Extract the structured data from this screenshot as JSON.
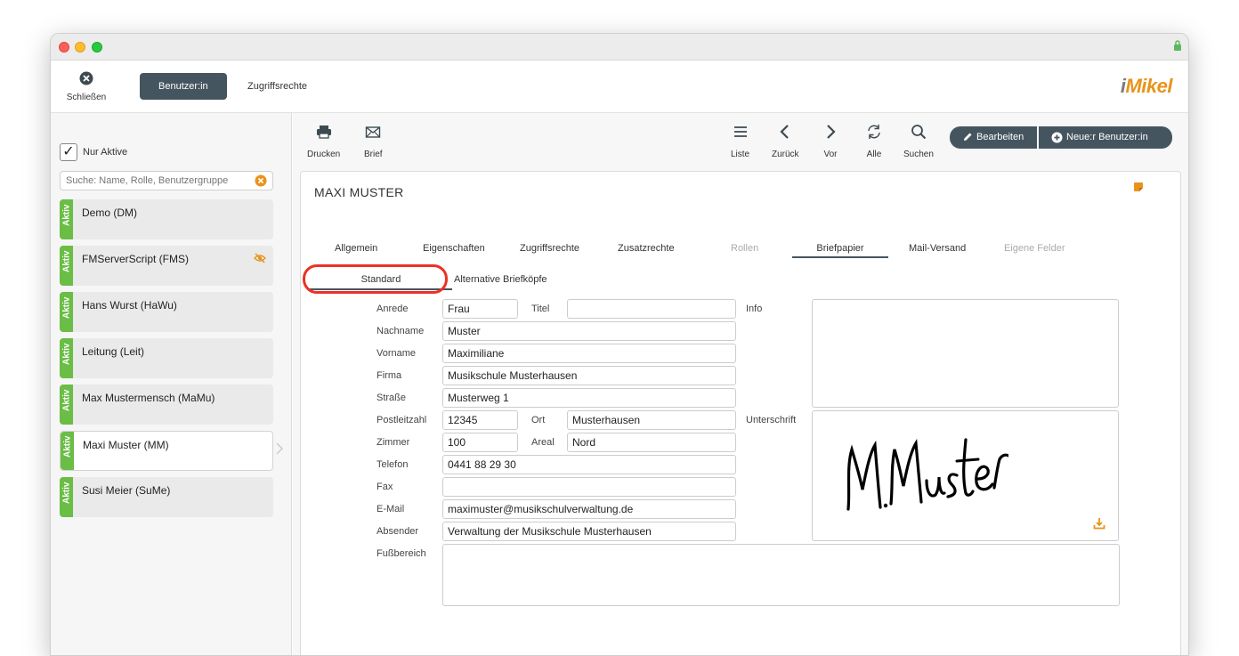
{
  "window": {
    "colors": {
      "accent": "#455560",
      "status_green": "#6abd45",
      "highlight_red": "#ee3024",
      "brand_orange": "#e8931a"
    }
  },
  "topbar": {
    "close_label": "Schließen",
    "tab_user": "Benutzer:in",
    "tab_access": "Zugriffsrechte",
    "logo_i": "i",
    "logo_rest": "Mikel"
  },
  "sidebar": {
    "only_active_label": "Nur Aktive",
    "only_active_checked": "✓",
    "search_placeholder": "Suche: Name, Rolle, Benutzergruppe",
    "status_label": "Aktiv",
    "users": [
      {
        "name": "Demo (DM)"
      },
      {
        "name": "FMServerScript (FMS)"
      },
      {
        "name": "Hans Wurst (HaWu)"
      },
      {
        "name": "Leitung (Leit)"
      },
      {
        "name": "Max Mustermensch (MaMu)"
      },
      {
        "name": "Maxi Muster (MM)"
      },
      {
        "name": "Susi Meier (SuMe)"
      }
    ]
  },
  "toolbar": {
    "print": "Drucken",
    "letter": "Brief",
    "list": "Liste",
    "back": "Zurück",
    "next": "Vor",
    "all": "Alle",
    "search": "Suchen",
    "edit": "Bearbeiten",
    "new_user": "Neue:r Benutzer:in"
  },
  "record": {
    "title": "MAXI MUSTER",
    "tabs": {
      "general": "Allgemein",
      "properties": "Eigenschaften",
      "access": "Zugriffsrechte",
      "extra": "Zusatzrechte",
      "roles": "Rollen",
      "letterhead": "Briefpapier",
      "mail": "Mail-Versand",
      "custom": "Eigene Felder"
    },
    "subtabs": {
      "standard": "Standard",
      "alternative": "Alternative Briefköpfe"
    },
    "labels": {
      "salutation": "Anrede",
      "title": "Titel",
      "info": "Info",
      "lastname": "Nachname",
      "firstname": "Vorname",
      "company": "Firma",
      "street": "Straße",
      "zip": "Postleitzahl",
      "city": "Ort",
      "signature": "Unterschrift",
      "room": "Zimmer",
      "area": "Areal",
      "phone": "Telefon",
      "fax": "Fax",
      "email": "E-Mail",
      "sender": "Absender",
      "footer": "Fußbereich"
    },
    "values": {
      "salutation": "Frau",
      "title": "",
      "lastname": "Muster",
      "firstname": "Maximiliane",
      "company": "Musikschule Musterhausen",
      "street": "Musterweg 1",
      "zip": "12345",
      "city": "Musterhausen",
      "room": "100",
      "area": "Nord",
      "phone": "0441 88 29 30",
      "fax": "",
      "email": "maximuster@musikschulverwaltung.de",
      "sender": "Verwaltung der Musikschule Musterhausen",
      "footer": "",
      "signature_text": "M.Muster"
    }
  }
}
